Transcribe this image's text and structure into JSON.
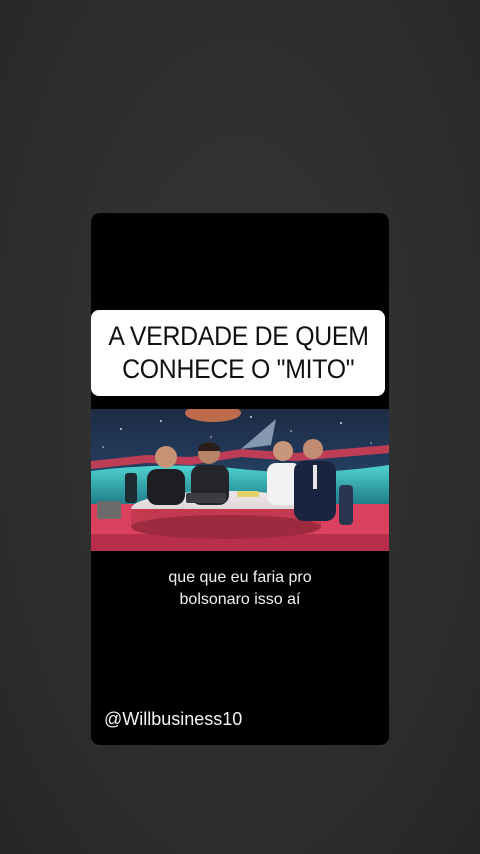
{
  "post": {
    "title_lines": [
      "A VERDADE DE QUEM",
      "CONHECE O \"MITO\""
    ],
    "video_alt": "TV studio talk show scene with four men seated at a desk",
    "subtitle_lines": [
      "que que eu faria pro",
      "bolsonaro isso aí"
    ],
    "author_handle": "@Willbusiness10"
  },
  "colors": {
    "background": "#2f2f2f",
    "card": "#000000",
    "title_box": "#ffffff",
    "title_text": "#111111",
    "caption_text": "#f2f2f2"
  }
}
